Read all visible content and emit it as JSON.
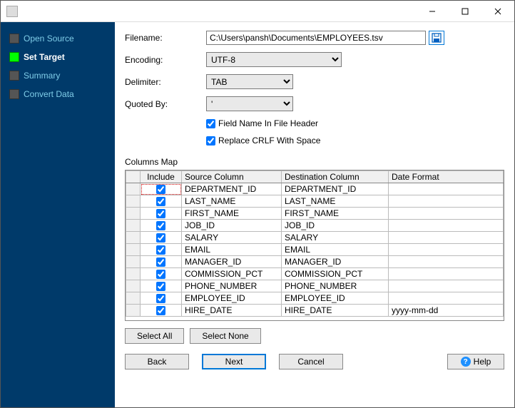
{
  "titlebar": {
    "title": ""
  },
  "sidebar": {
    "items": [
      {
        "label": "Open Source"
      },
      {
        "label": "Set Target"
      },
      {
        "label": "Summary"
      },
      {
        "label": "Convert Data"
      }
    ]
  },
  "form": {
    "filename_label": "Filename:",
    "filename_value": "C:\\Users\\pansh\\Documents\\EMPLOYEES.tsv",
    "encoding_label": "Encoding:",
    "encoding_value": "UTF-8",
    "delimiter_label": "Delimiter:",
    "delimiter_value": "TAB",
    "quoted_label": "Quoted By:",
    "quoted_value": "'",
    "cb_header_label": "Field Name In File Header",
    "cb_header_checked": true,
    "cb_crlf_label": "Replace CRLF With Space",
    "cb_crlf_checked": true
  },
  "columns_map": {
    "title": "Columns Map",
    "headers": {
      "include": "Include",
      "source": "Source Column",
      "dest": "Destination Column",
      "date": "Date Format"
    },
    "rows": [
      {
        "include": true,
        "source": "DEPARTMENT_ID",
        "dest": "DEPARTMENT_ID",
        "date": ""
      },
      {
        "include": true,
        "source": "LAST_NAME",
        "dest": "LAST_NAME",
        "date": ""
      },
      {
        "include": true,
        "source": "FIRST_NAME",
        "dest": "FIRST_NAME",
        "date": ""
      },
      {
        "include": true,
        "source": "JOB_ID",
        "dest": "JOB_ID",
        "date": ""
      },
      {
        "include": true,
        "source": "SALARY",
        "dest": "SALARY",
        "date": ""
      },
      {
        "include": true,
        "source": "EMAIL",
        "dest": "EMAIL",
        "date": ""
      },
      {
        "include": true,
        "source": "MANAGER_ID",
        "dest": "MANAGER_ID",
        "date": ""
      },
      {
        "include": true,
        "source": "COMMISSION_PCT",
        "dest": "COMMISSION_PCT",
        "date": ""
      },
      {
        "include": true,
        "source": "PHONE_NUMBER",
        "dest": "PHONE_NUMBER",
        "date": ""
      },
      {
        "include": true,
        "source": "EMPLOYEE_ID",
        "dest": "EMPLOYEE_ID",
        "date": ""
      },
      {
        "include": true,
        "source": "HIRE_DATE",
        "dest": "HIRE_DATE",
        "date": "yyyy-mm-dd"
      }
    ]
  },
  "buttons": {
    "select_all": "Select All",
    "select_none": "Select None",
    "back": "Back",
    "next": "Next",
    "cancel": "Cancel",
    "help": "Help"
  }
}
